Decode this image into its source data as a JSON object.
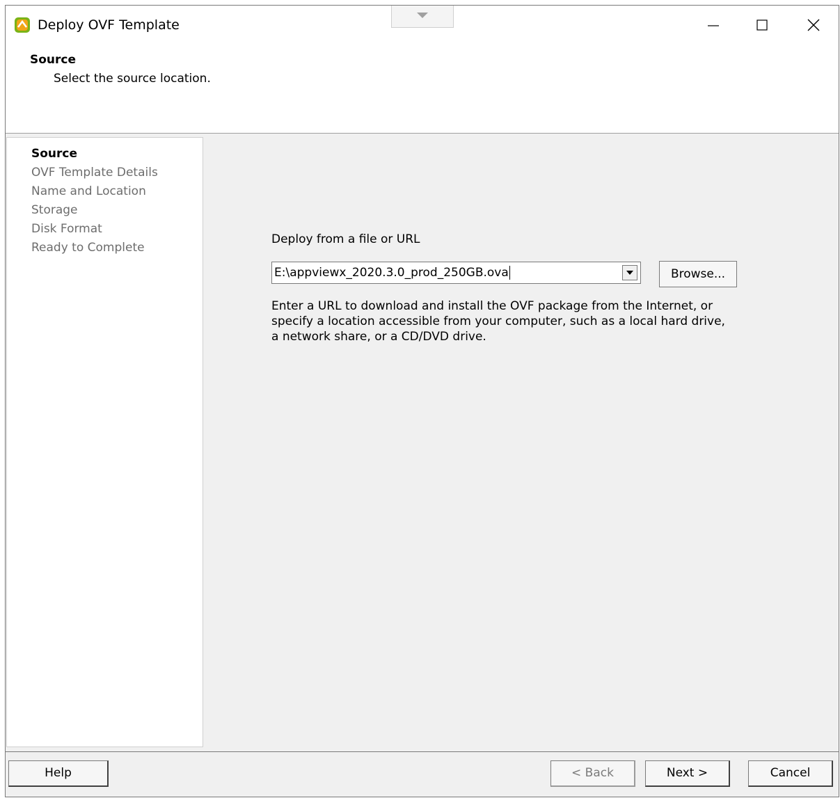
{
  "window": {
    "title": "Deploy OVF Template",
    "icon": "vsphere-app-icon",
    "controls": [
      "minimize-icon",
      "maximize-icon",
      "close-icon"
    ]
  },
  "header": {
    "title": "Source",
    "subtitle": "Select the source location."
  },
  "steps": [
    {
      "label": "Source",
      "active": true
    },
    {
      "label": "OVF Template Details",
      "active": false
    },
    {
      "label": "Name and Location",
      "active": false
    },
    {
      "label": "Storage",
      "active": false
    },
    {
      "label": "Disk Format",
      "active": false
    },
    {
      "label": "Ready to Complete",
      "active": false
    }
  ],
  "main": {
    "deploy_label": "Deploy from a file or URL",
    "source_value": "E:\\appviewx_2020.3.0_prod_250GB.ova",
    "browse_label": "Browse...",
    "help_text": "Enter a URL to download and install the OVF package from the Internet, or specify a location accessible from your computer, such as a local hard drive, a network share, or a CD/DVD drive."
  },
  "footer": {
    "help_label": "Help",
    "back_label": "< Back",
    "next_label": "Next >",
    "cancel_label": "Cancel"
  }
}
